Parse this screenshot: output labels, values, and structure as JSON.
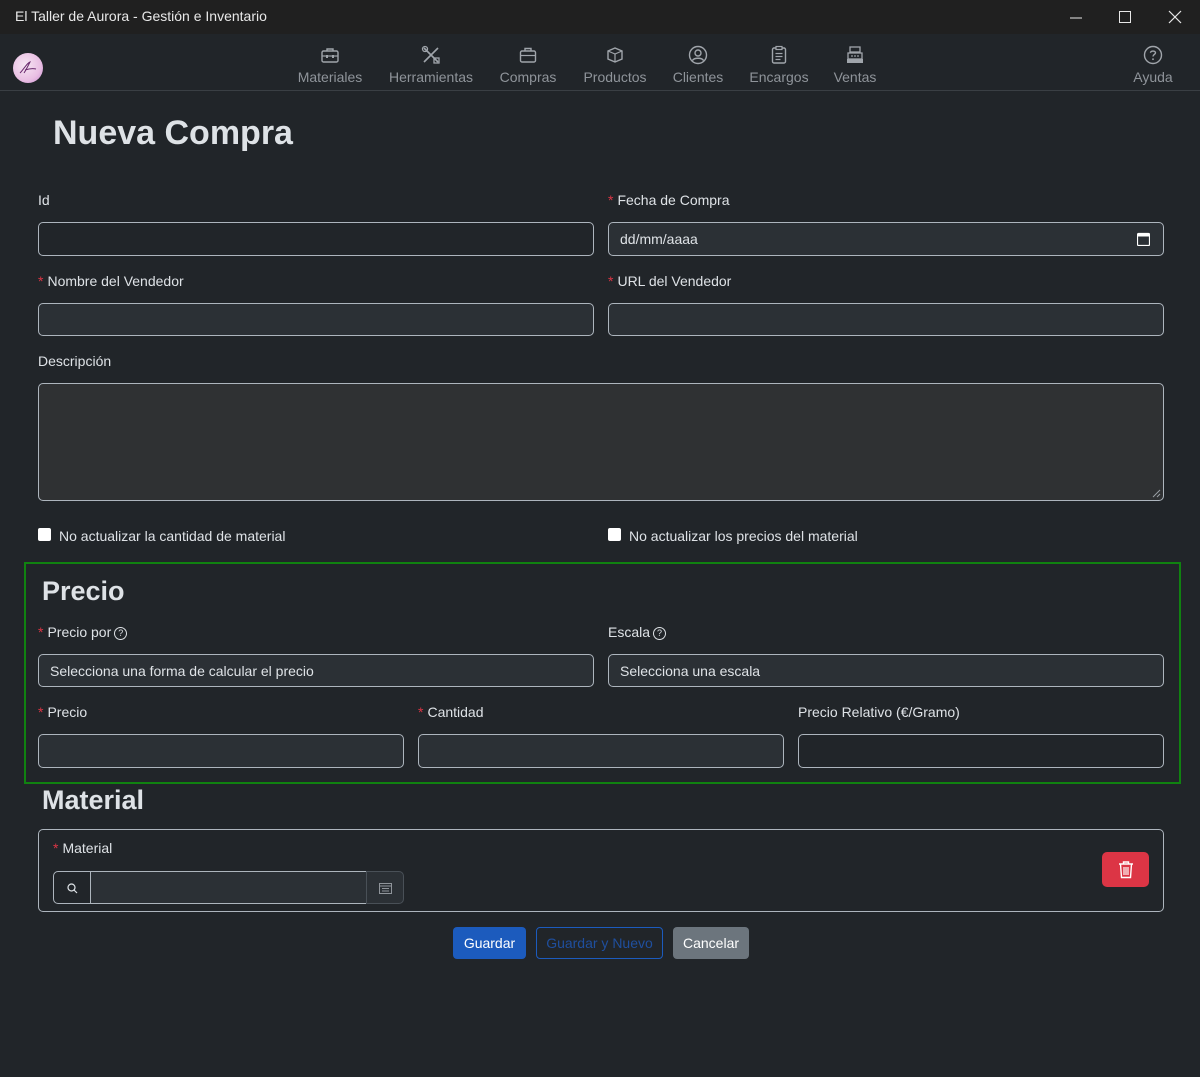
{
  "window": {
    "title": "El Taller de Aurora - Gestión e Inventario",
    "minimize_glyph": "—",
    "maximize_glyph": "☐",
    "close_glyph": "✕"
  },
  "nav": {
    "items": [
      {
        "label": "Materiales",
        "icon": "toolbox-icon"
      },
      {
        "label": "Herramientas",
        "icon": "tools-icon"
      },
      {
        "label": "Compras",
        "icon": "briefcase-icon"
      },
      {
        "label": "Productos",
        "icon": "box-icon"
      },
      {
        "label": "Clientes",
        "icon": "user-circle-icon"
      },
      {
        "label": "Encargos",
        "icon": "clipboard-icon"
      },
      {
        "label": "Ventas",
        "icon": "cash-register-icon"
      }
    ],
    "help": {
      "label": "Ayuda",
      "icon": "question-circle-icon"
    }
  },
  "page": {
    "title": "Nueva Compra"
  },
  "form": {
    "id_label": "Id",
    "id_value": "",
    "fecha_label": "Fecha de Compra",
    "fecha_placeholder": "dd/mm/aaaa",
    "vendedor_label": "Nombre del Vendedor",
    "url_label": "URL del Vendedor",
    "descripcion_label": "Descripción",
    "no_actualizar_cantidad": "No actualizar la cantidad de material",
    "no_actualizar_precios": "No actualizar los precios del material"
  },
  "precio": {
    "heading": "Precio",
    "precio_por_label": "Precio por",
    "precio_por_value": "Selecciona una forma de calcular el precio",
    "escala_label": "Escala",
    "escala_value": "Selecciona una escala",
    "precio_label": "Precio",
    "cantidad_label": "Cantidad",
    "relativo_label": "Precio Relativo (€/Gramo)",
    "help_glyph": "?"
  },
  "material": {
    "heading": "Material",
    "material_label": "Material",
    "search_value": ""
  },
  "required_mark": "*",
  "buttons": {
    "guardar": "Guardar",
    "guardar_nuevo": "Guardar y Nuevo",
    "cancelar": "Cancelar"
  },
  "colors": {
    "background": "#212529",
    "accent_blue": "#1c5bbd",
    "danger": "#dc3545",
    "section_border": "#108210",
    "secondary": "#6c757d"
  }
}
